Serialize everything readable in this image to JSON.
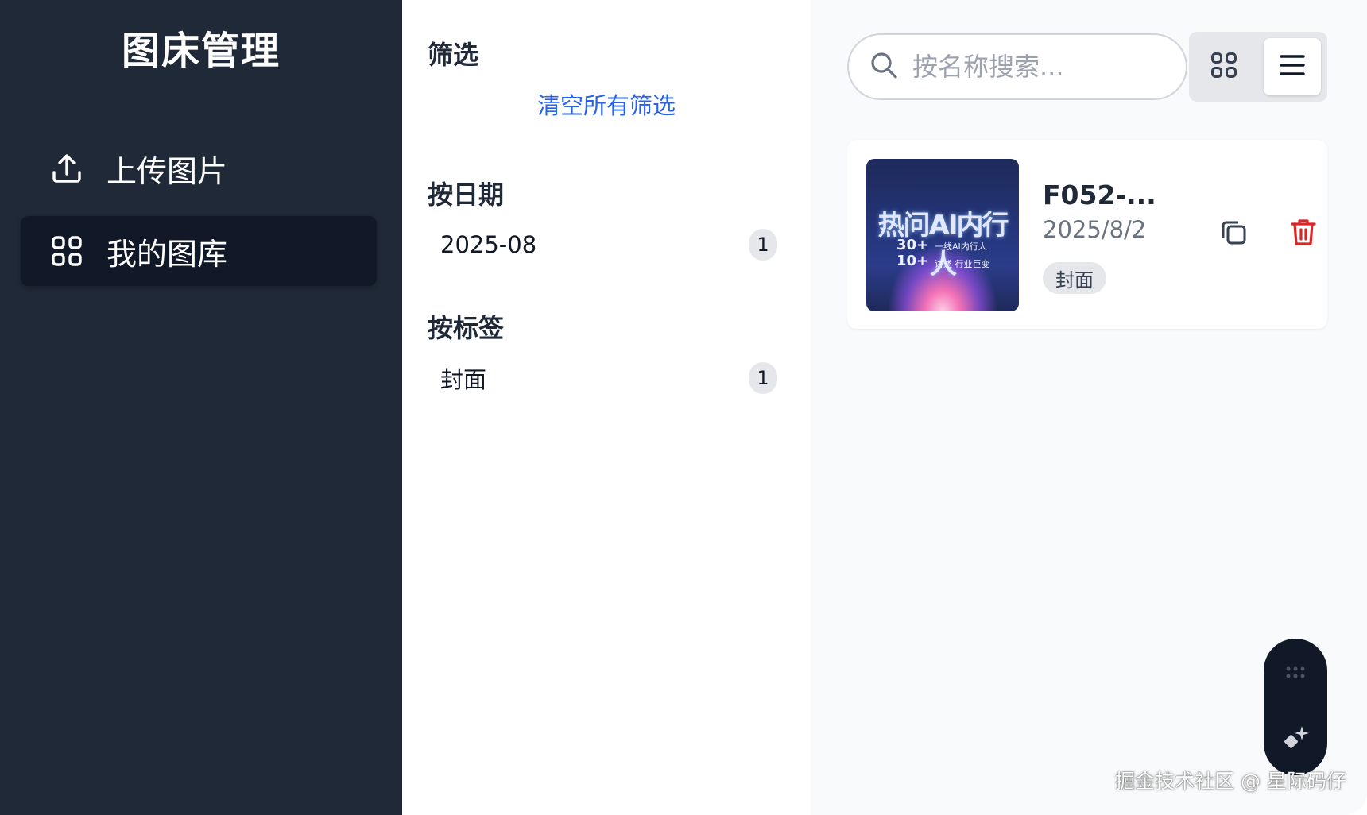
{
  "sidebar": {
    "title": "图床管理",
    "items": [
      {
        "label": "上传图片",
        "icon": "upload-icon"
      },
      {
        "label": "我的图库",
        "icon": "grid-icon",
        "active": true
      }
    ]
  },
  "filters": {
    "heading": "筛选",
    "clear_label": "清空所有筛选",
    "by_date": {
      "heading": "按日期",
      "items": [
        {
          "label": "2025-08",
          "count": "1"
        }
      ]
    },
    "by_tag": {
      "heading": "按标签",
      "items": [
        {
          "label": "封面",
          "count": "1"
        }
      ]
    }
  },
  "main": {
    "search": {
      "placeholder": "按名称搜索...",
      "value": "",
      "icon": "search-icon"
    },
    "view_toggle": {
      "options": [
        "grid-view-icon",
        "list-view-icon"
      ],
      "selected": "list"
    },
    "images": [
      {
        "name": "F052-...",
        "date": "2025/8/2",
        "tags": [
          "封面"
        ],
        "thumbnail_text": {
          "headline": "热问AI内行人",
          "line1_num": "30+",
          "line1_text": "一线AI内行人",
          "line2_num": "10+",
          "line2_text": "讲述 行业巨变"
        },
        "actions": [
          "copy-icon",
          "delete-icon"
        ]
      }
    ]
  },
  "watermark": "掘金技术社区 @ 星际码仔",
  "colors": {
    "sidebar_bg": "#1f2937",
    "sidebar_active": "#111827",
    "link": "#2563eb",
    "delete": "#dc2626"
  }
}
